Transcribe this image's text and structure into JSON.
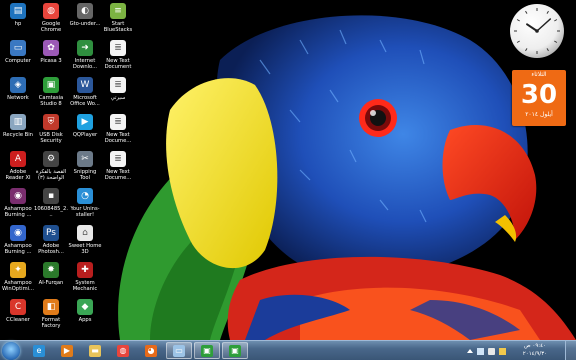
{
  "desktop_icons": [
    {
      "label": "hp",
      "color": "#1e73be",
      "glyph": "▤"
    },
    {
      "label": "Computer",
      "color": "#3a78c2",
      "glyph": "▭"
    },
    {
      "label": "Network",
      "color": "#2e6db4",
      "glyph": "◈"
    },
    {
      "label": "Recycle Bin",
      "color": "#8aa6c0",
      "glyph": "▥"
    },
    {
      "label": "Adobe Reader XI",
      "color": "#cc1e1e",
      "glyph": "A"
    },
    {
      "label": "Ashampoo Burning ...",
      "color": "#7a2d6e",
      "glyph": "◉"
    },
    {
      "label": "Ashampoo Burning ...",
      "color": "#3366cc",
      "glyph": "◉"
    },
    {
      "label": "Ashampoo WinOptimi...",
      "color": "#e6a81e",
      "glyph": "✦"
    },
    {
      "label": "CCleaner",
      "color": "#d9362b",
      "glyph": "C"
    },
    {
      "label": "Google Chrome",
      "color": "#e8453c",
      "glyph": "◍"
    },
    {
      "label": "Picasa 3",
      "color": "#9b59b6",
      "glyph": "✿"
    },
    {
      "label": "Camtasia Studio 8",
      "color": "#2e9e3a",
      "glyph": "▣"
    },
    {
      "label": "USB Disk Security",
      "color": "#c0392b",
      "glyph": "⛨"
    },
    {
      "label": "القصة بالفكرة الواضحة (٣)",
      "color": "#444444",
      "glyph": "⚙"
    },
    {
      "label": "10608485_2...",
      "color": "#444444",
      "glyph": "▪"
    },
    {
      "label": "Adobe Photosh...",
      "color": "#1f4f8f",
      "glyph": "Ps"
    },
    {
      "label": "Al-Furqan",
      "color": "#2b7a2b",
      "glyph": "✸"
    },
    {
      "label": "Format Factory",
      "color": "#e07b1a",
      "glyph": "◧"
    },
    {
      "label": "Gto-under...",
      "color": "#666666",
      "glyph": "◐"
    },
    {
      "label": "Internet Downlo...",
      "color": "#2f8f3f",
      "glyph": "➜"
    },
    {
      "label": "Microsoft Office Wo...",
      "color": "#2b579a",
      "glyph": "W"
    },
    {
      "label": "QQPlayer",
      "color": "#1fa1e0",
      "glyph": "▶"
    },
    {
      "label": "Snipping Tool",
      "color": "#6c7a89",
      "glyph": "✂"
    },
    {
      "label": "Your Unins-staller!",
      "color": "#2a8fd6",
      "glyph": "◔"
    },
    {
      "label": "Sweet Home 3D",
      "color": "#e8e8e8",
      "glyph": "⌂"
    },
    {
      "label": "System Mechanic",
      "color": "#b81e1e",
      "glyph": "✚"
    },
    {
      "label": "Apps",
      "color": "#3aa655",
      "glyph": "◆"
    },
    {
      "label": "Start BlueStacks",
      "color": "#7cb342",
      "glyph": "≡"
    },
    {
      "label": "New Text Document",
      "color": "#f4f4f4",
      "glyph": "≣"
    },
    {
      "label": "سيرتي",
      "color": "#f4f4f4",
      "glyph": "≣"
    },
    {
      "label": "New Text Docume...",
      "color": "#f4f4f4",
      "glyph": "≣"
    },
    {
      "label": "New Text Docume...",
      "color": "#f4f4f4",
      "glyph": "≣"
    }
  ],
  "clock_gadget": {
    "hour": 10,
    "minute": 8
  },
  "calendar_gadget": {
    "day_name": "الثلاثاء",
    "day": "30",
    "month_year": "أيلول ٢٠١٤"
  },
  "taskbar": {
    "buttons": [
      {
        "name": "ie",
        "color": "#2a8fd6",
        "glyph": "e"
      },
      {
        "name": "media-player",
        "color": "#e07b1a",
        "glyph": "▶"
      },
      {
        "name": "explorer",
        "color": "#e7c35a",
        "glyph": "▬"
      },
      {
        "name": "chrome",
        "color": "#e8453c",
        "glyph": "◍"
      },
      {
        "name": "firefox",
        "color": "#e66a1a",
        "glyph": "◕"
      },
      {
        "name": "window",
        "color": "#9cc3e6",
        "glyph": "▭"
      },
      {
        "name": "camtasia-1",
        "color": "#2e9e3a",
        "glyph": "▣"
      },
      {
        "name": "camtasia-2",
        "color": "#2e9e3a",
        "glyph": "▣"
      }
    ],
    "clock_time": "٠٩:٤٠ ص",
    "clock_date": "٢٠١٤/٩/٣٠"
  }
}
